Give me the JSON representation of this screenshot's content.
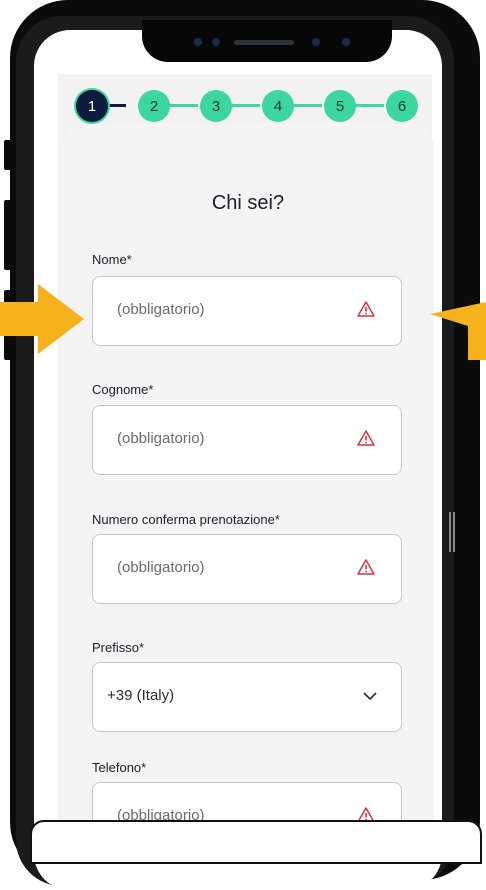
{
  "stepper": {
    "steps": [
      "1",
      "2",
      "3",
      "4",
      "5",
      "6"
    ],
    "active_index": 0,
    "active_color": "#0d1b3e",
    "step_color": "#3ed6a0"
  },
  "form": {
    "title": "Chi sei?",
    "fields": {
      "nome": {
        "label": "Nome*",
        "placeholder": "(obbligatorio)"
      },
      "cognome": {
        "label": "Cognome*",
        "placeholder": "(obbligatorio)"
      },
      "numero": {
        "label": "Numero conferma prenotazione*",
        "placeholder": "(obbligatorio)"
      },
      "prefisso": {
        "label": "Prefisso*",
        "value": "+39 (Italy)"
      },
      "telefono": {
        "label": "Telefono*",
        "placeholder": "(obbligatorio)"
      }
    }
  },
  "colors": {
    "warning": "#d9343a",
    "annotation_arrow": "#f5b21b"
  },
  "icons": [
    "warning-triangle-icon",
    "chevron-down-icon",
    "arrow-right-icon",
    "arrow-left-icon"
  ]
}
